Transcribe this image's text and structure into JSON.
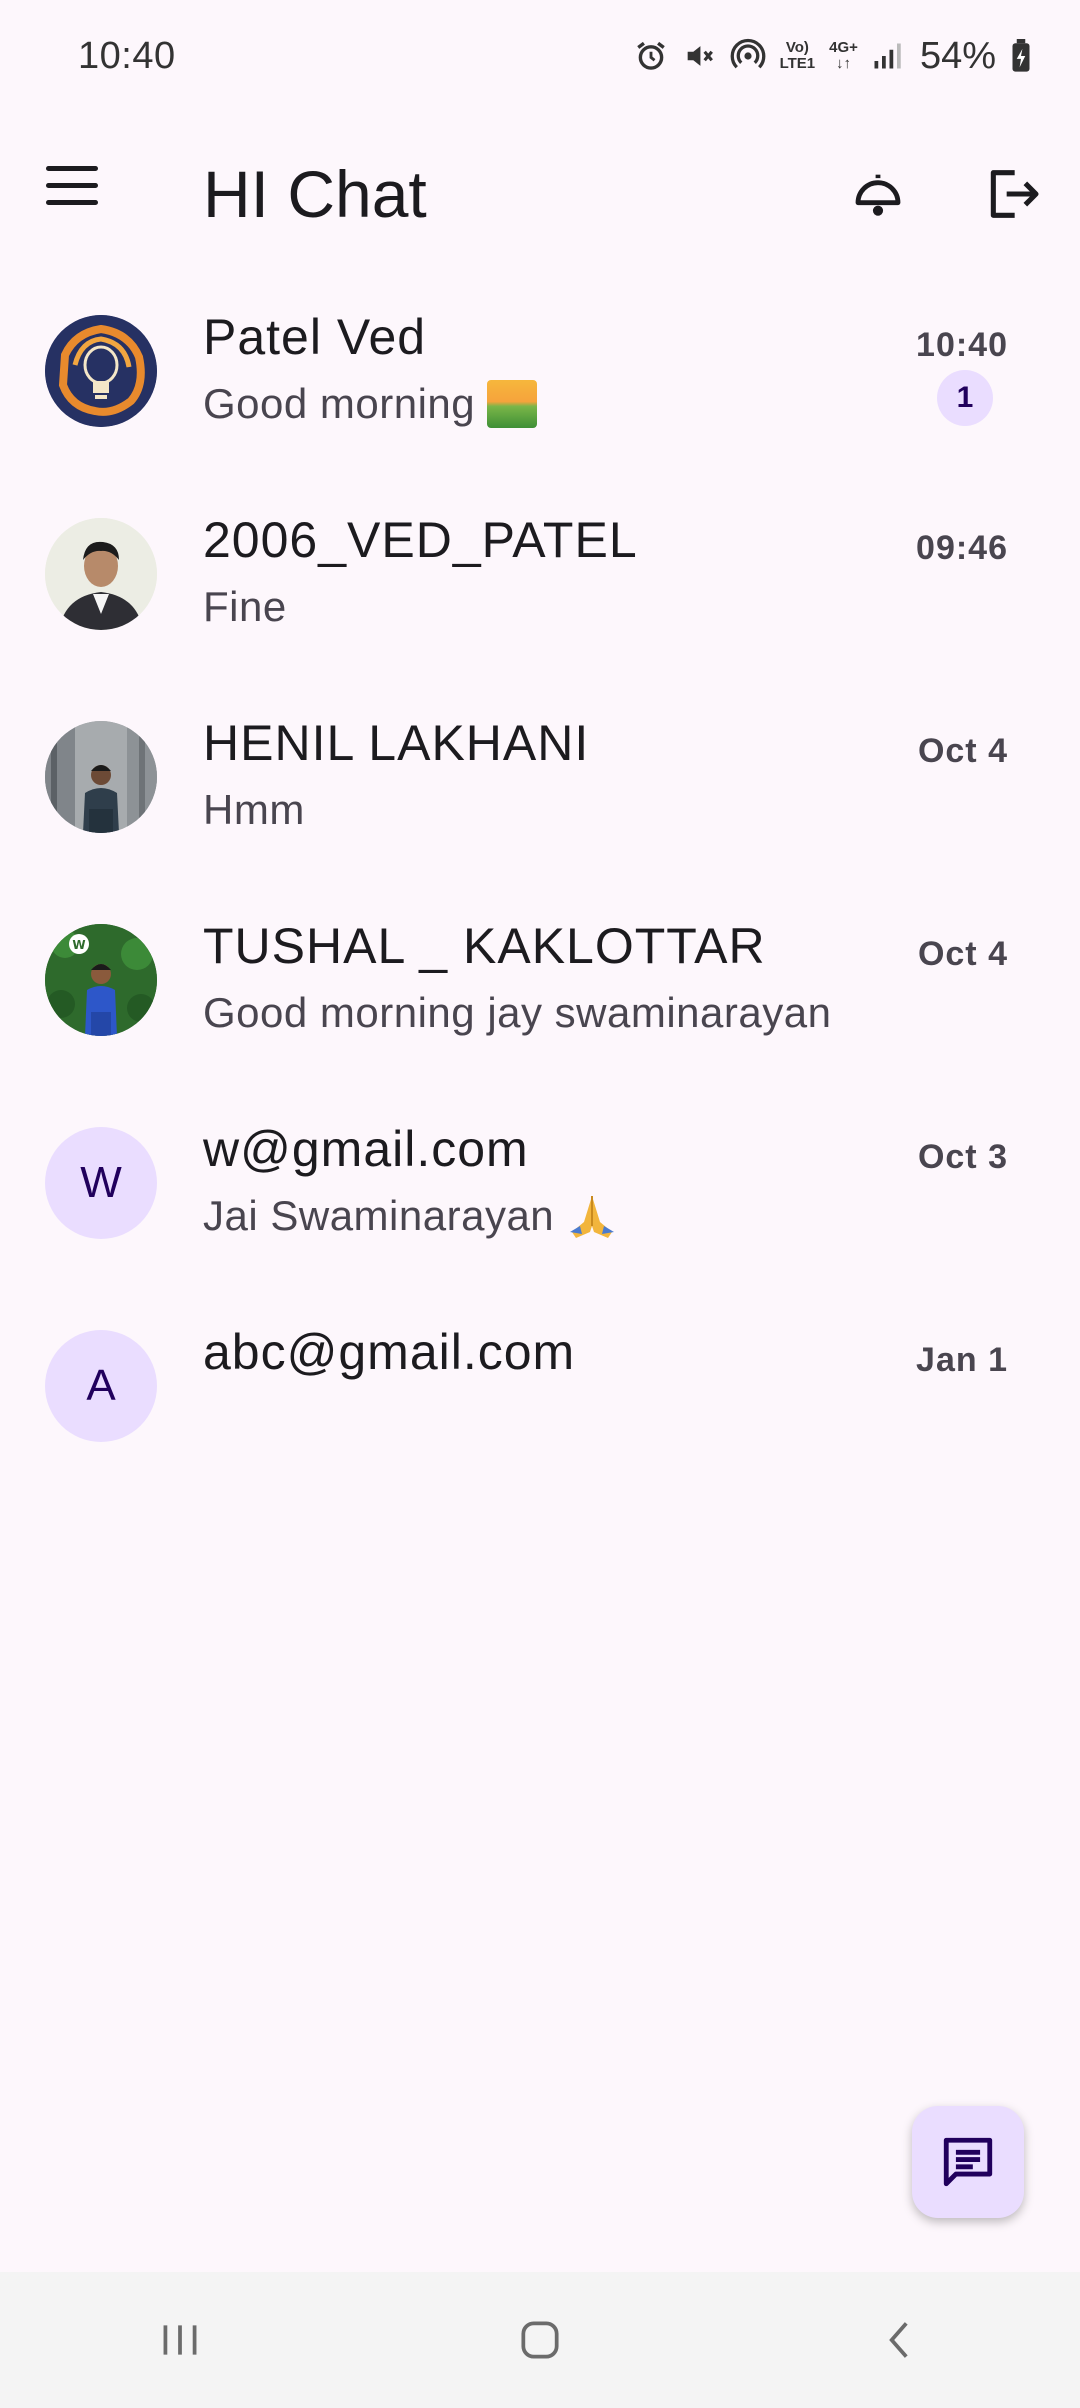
{
  "status_bar": {
    "time": "10:40",
    "volte_line1": "Vo)",
    "volte_line2": "LTE1",
    "network": "4G+",
    "battery": "54%",
    "icons": [
      "alarm-icon",
      "mute-icon",
      "hotspot-icon",
      "volte-icon",
      "network-icon",
      "signal-icon",
      "battery-icon"
    ]
  },
  "app_bar": {
    "title": "HI Chat",
    "icons": [
      "menu-icon",
      "notification-bell-icon",
      "logout-icon"
    ]
  },
  "chats": [
    {
      "name": "Patel Ved",
      "preview": "Good morning",
      "preview_emoji": "sunrise-emoji",
      "time": "10:40",
      "unread": "1",
      "avatar": "lightbulb-photo"
    },
    {
      "name": "2006_VED_PATEL",
      "preview": "Fine",
      "time": "09:46",
      "avatar": "person-photo"
    },
    {
      "name": "HENIL LAKHANI",
      "preview": "Hmm",
      "time": "Oct 4",
      "avatar": "person-photo"
    },
    {
      "name": "TUSHAL _ KAKLOTTAR",
      "preview": "Good morning jay swaminarayan",
      "time": "Oct 4",
      "avatar": "person-photo"
    },
    {
      "name": "w@gmail.com",
      "preview": "Jai Swaminarayan",
      "preview_emoji": "folded-hands-emoji",
      "time": "Oct 3",
      "avatar_letter": "W"
    },
    {
      "name": "abc@gmail.com",
      "preview": "",
      "time": "Jan 1",
      "avatar_letter": "A"
    }
  ],
  "fab": {
    "icon": "new-message-icon"
  },
  "nav_bar": {
    "icons": [
      "recent-apps-icon",
      "home-icon",
      "back-icon"
    ]
  },
  "colors": {
    "background": "#FDF7FC",
    "accent_container": "#EADDFF",
    "on_accent": "#21005D"
  }
}
